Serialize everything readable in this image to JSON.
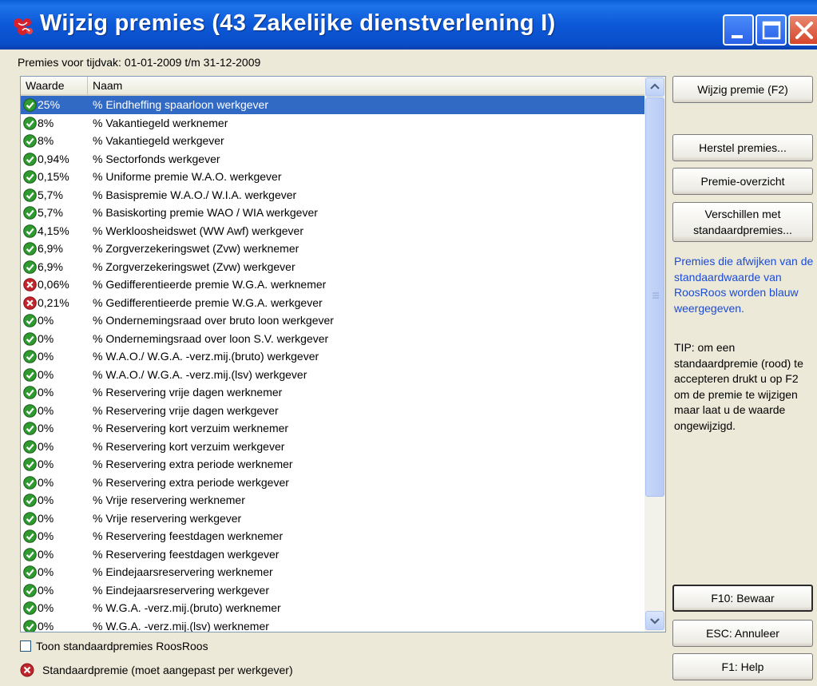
{
  "window": {
    "title": "Wijzig premies (43 Zakelijke dienstverlening I)"
  },
  "period": {
    "label": "Premies voor tijdvak:",
    "value": "01-01-2009 t/m 31-12-2009"
  },
  "table": {
    "columns": [
      "Waarde",
      "Naam"
    ],
    "rows": [
      {
        "value": "25%",
        "name": "% Eindheffing spaarloon werkgever",
        "status": "ok",
        "selected": true
      },
      {
        "value": "8%",
        "name": "% Vakantiegeld werknemer",
        "status": "ok"
      },
      {
        "value": "8%",
        "name": "% Vakantiegeld werkgever",
        "status": "ok"
      },
      {
        "value": "0,94%",
        "name": "% Sectorfonds werkgever",
        "status": "ok"
      },
      {
        "value": "0,15%",
        "name": "% Uniforme premie W.A.O. werkgever",
        "status": "ok"
      },
      {
        "value": "5,7%",
        "name": "% Basispremie W.A.O./ W.I.A. werkgever",
        "status": "ok"
      },
      {
        "value": "5,7%",
        "name": "% Basiskorting premie WAO / WIA werkgever",
        "status": "ok"
      },
      {
        "value": "4,15%",
        "name": "% Werkloosheidswet (WW Awf) werkgever",
        "status": "ok"
      },
      {
        "value": "6,9%",
        "name": "% Zorgverzekeringswet (Zvw) werknemer",
        "status": "ok"
      },
      {
        "value": "6,9%",
        "name": "% Zorgverzekeringswet (Zvw) werkgever",
        "status": "ok"
      },
      {
        "value": "0,06%",
        "name": "% Gedifferentieerde premie W.G.A. werknemer",
        "status": "error"
      },
      {
        "value": "0,21%",
        "name": "% Gedifferentieerde premie W.G.A. werkgever",
        "status": "error"
      },
      {
        "value": "0%",
        "name": "% Ondernemingsraad over bruto loon werkgever",
        "status": "ok"
      },
      {
        "value": "0%",
        "name": "% Ondernemingsraad over loon S.V. werkgever",
        "status": "ok"
      },
      {
        "value": "0%",
        "name": "% W.A.O./ W.G.A. -verz.mij.(bruto) werkgever",
        "status": "ok"
      },
      {
        "value": "0%",
        "name": "% W.A.O./ W.G.A. -verz.mij.(lsv) werkgever",
        "status": "ok"
      },
      {
        "value": "0%",
        "name": "% Reservering vrije dagen werknemer",
        "status": "ok"
      },
      {
        "value": "0%",
        "name": "% Reservering vrije dagen werkgever",
        "status": "ok"
      },
      {
        "value": "0%",
        "name": "% Reservering kort verzuim werknemer",
        "status": "ok"
      },
      {
        "value": "0%",
        "name": "% Reservering kort verzuim werkgever",
        "status": "ok"
      },
      {
        "value": "0%",
        "name": "% Reservering extra periode werknemer",
        "status": "ok"
      },
      {
        "value": "0%",
        "name": "% Reservering extra periode werkgever",
        "status": "ok"
      },
      {
        "value": "0%",
        "name": "% Vrije reservering werknemer",
        "status": "ok"
      },
      {
        "value": "0%",
        "name": "% Vrije reservering werkgever",
        "status": "ok"
      },
      {
        "value": "0%",
        "name": "% Reservering feestdagen werknemer",
        "status": "ok"
      },
      {
        "value": "0%",
        "name": "% Reservering feestdagen werkgever",
        "status": "ok"
      },
      {
        "value": "0%",
        "name": "% Eindejaarsreservering werknemer",
        "status": "ok"
      },
      {
        "value": "0%",
        "name": "% Eindejaarsreservering werkgever",
        "status": "ok"
      },
      {
        "value": "0%",
        "name": "% W.G.A. -verz.mij.(bruto) werknemer",
        "status": "ok"
      },
      {
        "value": "0%",
        "name": "% W.G.A. -verz.mij.(lsv) werknemer",
        "status": "ok"
      }
    ]
  },
  "options": {
    "show_standard_label": "Toon standaardpremies RoosRoos",
    "show_standard_checked": false,
    "legend_label": "Standaardpremie (moet aangepast per werkgever)"
  },
  "buttons": {
    "wijzig": "Wijzig premie (F2)",
    "herstel": "Herstel premies...",
    "overzicht": "Premie-overzicht",
    "verschillen": "Verschillen met standaardpremies...",
    "bewaar": "F10: Bewaar",
    "annuleer": "ESC: Annuleer",
    "help": "F1: Help"
  },
  "info": {
    "blue_note": "Premies die afwijken van de standaardwaarde van RoosRoos worden blauw weergegeven.",
    "tip": "TIP: om een standaardpremie (rood) te accepteren drukt u op F2 om de premie te wijzigen maar laat u de waarde ongewijzigd."
  },
  "colors": {
    "titlebar": "#0a4ec9",
    "selection": "#316ac5",
    "ok_icon": "#2f9a2f",
    "error_icon": "#c0262c",
    "info_blue": "#1a4bd8"
  }
}
